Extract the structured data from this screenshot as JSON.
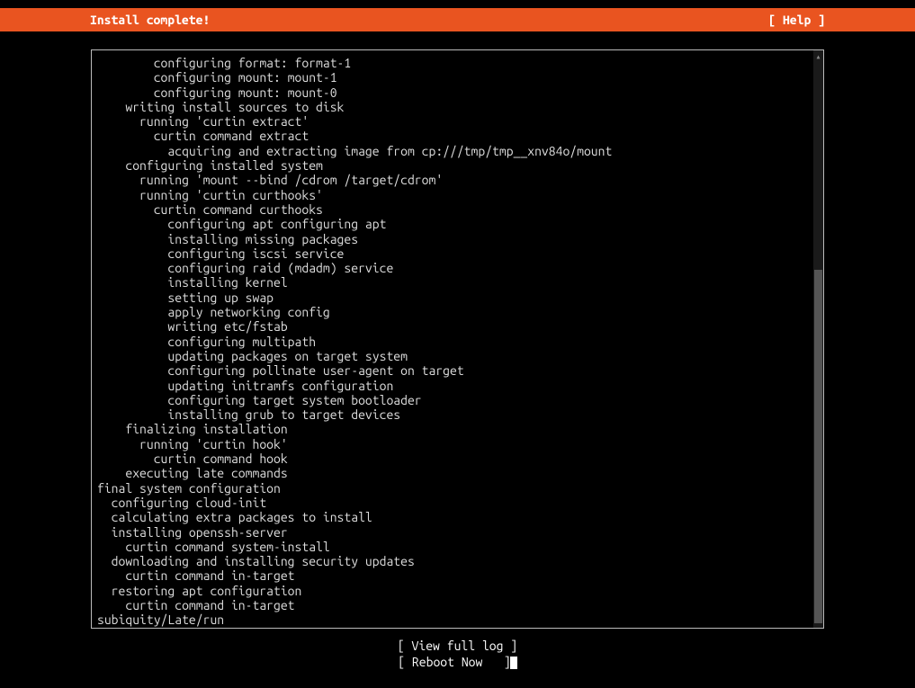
{
  "header": {
    "title": "Install complete!",
    "help": "[ Help ]"
  },
  "log": {
    "lines": [
      "        configuring format: format-1",
      "        configuring mount: mount-1",
      "        configuring mount: mount-0",
      "    writing install sources to disk",
      "      running 'curtin extract'",
      "        curtin command extract",
      "          acquiring and extracting image from cp:///tmp/tmp__xnv84o/mount",
      "    configuring installed system",
      "      running 'mount --bind /cdrom /target/cdrom'",
      "      running 'curtin curthooks'",
      "        curtin command curthooks",
      "          configuring apt configuring apt",
      "          installing missing packages",
      "          configuring iscsi service",
      "          configuring raid (mdadm) service",
      "          installing kernel",
      "          setting up swap",
      "          apply networking config",
      "          writing etc/fstab",
      "          configuring multipath",
      "          updating packages on target system",
      "          configuring pollinate user-agent on target",
      "          updating initramfs configuration",
      "          configuring target system bootloader",
      "          installing grub to target devices",
      "    finalizing installation",
      "      running 'curtin hook'",
      "        curtin command hook",
      "    executing late commands",
      "final system configuration",
      "  configuring cloud-init",
      "  calculating extra packages to install",
      "  installing openssh-server",
      "    curtin command system-install",
      "  downloading and installing security updates",
      "    curtin command in-target",
      "  restoring apt configuration",
      "    curtin command in-target",
      "subiquity/Late/run"
    ]
  },
  "actions": {
    "view_full_log": "[ View full log ]",
    "reboot_now": "[ Reboot Now   ]"
  }
}
